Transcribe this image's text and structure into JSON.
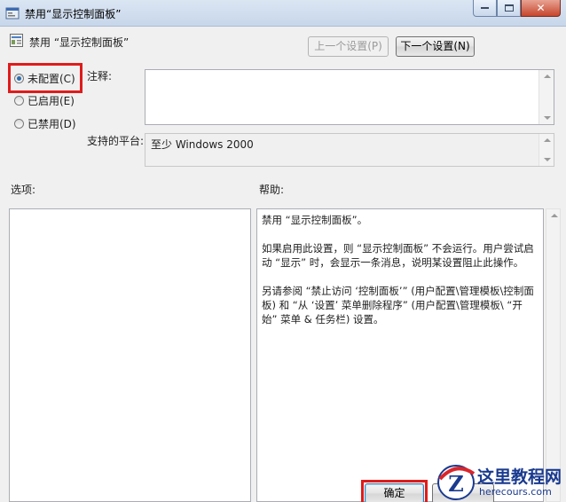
{
  "window": {
    "title": "禁用“显示控制面板”",
    "controls": [
      "minimize",
      "maximize",
      "close"
    ]
  },
  "header": {
    "icon": "policy-setting-icon",
    "title": "禁用 “显示控制面板”",
    "prev_label": "上一个设置(P)",
    "next_label": "下一个设置(N)"
  },
  "state": {
    "options": [
      {
        "label": "未配置(C)",
        "checked": true
      },
      {
        "label": "已启用(E)",
        "checked": false
      },
      {
        "label": "已禁用(D)",
        "checked": false
      }
    ]
  },
  "comment": {
    "label": "注释:",
    "value": ""
  },
  "platform": {
    "label": "支持的平台:",
    "value": "至少 Windows 2000"
  },
  "options_label": "选项:",
  "help": {
    "label": "帮助:",
    "paragraphs": [
      "禁用 “显示控制面板”。",
      "如果启用此设置，则 “显示控制面板” 不会运行。用户尝试启动 “显示” 时，会显示一条消息，说明某设置阻止此操作。",
      "另请参阅 “禁止访问 ‘控制面板’” (用户配置\\管理模板\\控制面板) 和 “从 ‘设置’ 菜单删除程序” (用户配置\\管理模板\\ “开始” 菜单 & 任务栏) 设置。"
    ]
  },
  "footer": {
    "ok_label": "确定"
  },
  "watermark": {
    "title": "这里教程网",
    "url": "herecours.com"
  },
  "colors": {
    "highlight": "#e01b1b",
    "radio_checked": "#2b6cae"
  }
}
